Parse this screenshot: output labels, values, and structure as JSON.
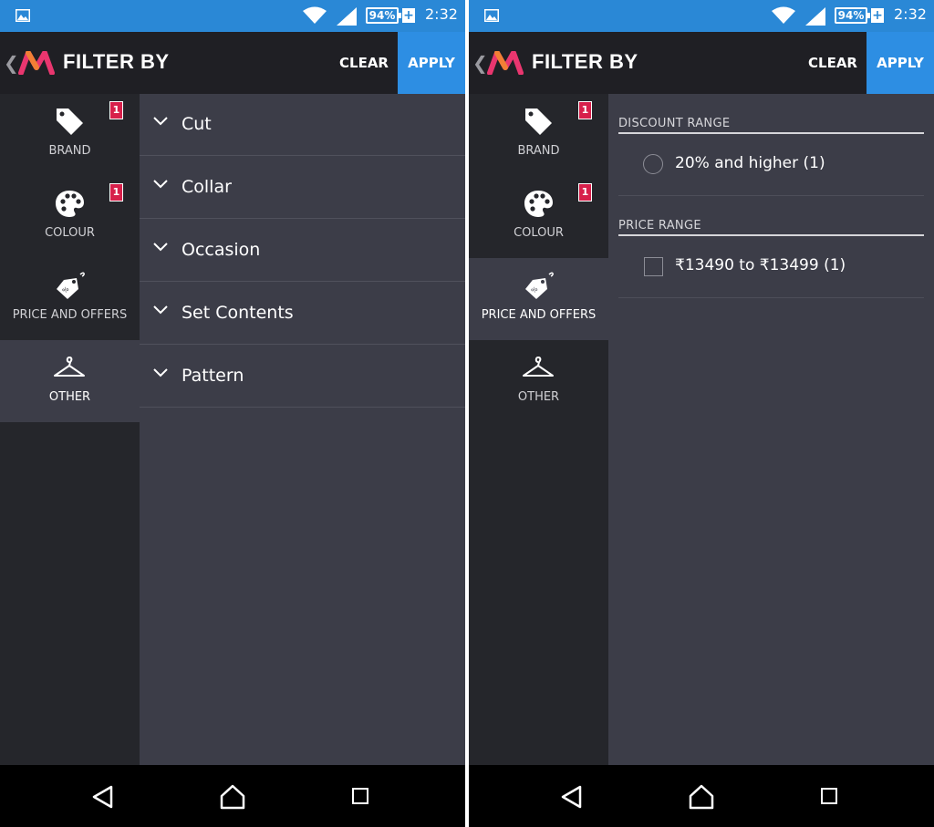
{
  "status_bar": {
    "battery": "94%",
    "charging": "+",
    "time": "2:32"
  },
  "header": {
    "title": "FILTER BY",
    "clear_label": "CLEAR",
    "apply_label": "APPLY"
  },
  "sidebar": {
    "items": [
      {
        "label": "BRAND",
        "icon": "tag-icon",
        "badge": "1"
      },
      {
        "label": "COLOUR",
        "icon": "palette-icon",
        "badge": "1"
      },
      {
        "label": "PRICE AND OFFERS",
        "icon": "price-tag-icon"
      },
      {
        "label": "OTHER",
        "icon": "hanger-icon"
      }
    ]
  },
  "left_screen": {
    "active_tab": "OTHER",
    "accordion": [
      {
        "label": "Cut"
      },
      {
        "label": "Collar"
      },
      {
        "label": "Occasion"
      },
      {
        "label": "Set Contents"
      },
      {
        "label": "Pattern"
      }
    ]
  },
  "right_screen": {
    "active_tab": "PRICE AND OFFERS",
    "discount_section": {
      "title": "DISCOUNT RANGE",
      "options": [
        {
          "label": "20% and higher (1)",
          "selected": false
        }
      ]
    },
    "price_section": {
      "title": "PRICE RANGE",
      "options": [
        {
          "label": "₹13490 to ₹13499 (1)",
          "checked": false
        }
      ]
    }
  },
  "colors": {
    "status_bar": "#2a88d6",
    "header": "#1f1f24",
    "apply_button": "#2d8ee3",
    "sidebar": "#25262b",
    "content": "#3c3d48",
    "badge": "#d7204b",
    "logo_pink": "#e9366f",
    "logo_orange": "#f27f35"
  }
}
